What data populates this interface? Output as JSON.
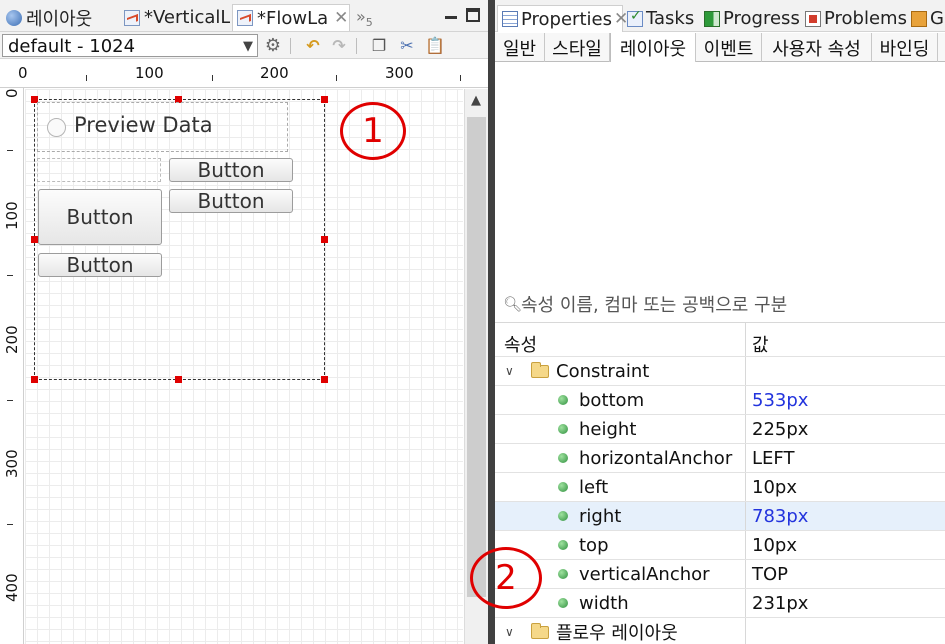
{
  "editor": {
    "tabs": [
      {
        "label": "레이아웃"
      },
      {
        "label": "*VerticalL"
      },
      {
        "label": "*FlowLa",
        "close": "✕"
      }
    ],
    "overflow_count": "5",
    "toolbar": {
      "resolution_value": "default - 1024",
      "icons": [
        "gear-icon",
        "undo-icon",
        "redo-icon",
        "copy-icon",
        "cut-icon",
        "paste-icon"
      ]
    },
    "ruler_top_labels": [
      "0",
      "100",
      "200",
      "300"
    ],
    "ruler_left_labels": [
      "0",
      "100",
      "200",
      "300",
      "400"
    ],
    "canvas": {
      "preview_label": "Preview Data",
      "buttons": [
        "Button",
        "Button",
        "Button",
        "Button"
      ]
    }
  },
  "annotations": {
    "one": "1",
    "two": "2",
    "color": "#e00000"
  },
  "properties": {
    "views": [
      {
        "label": "Properties",
        "close": "✕"
      },
      {
        "label": "Tasks"
      },
      {
        "label": "Progress"
      },
      {
        "label": "Problems"
      },
      {
        "label": "G"
      }
    ],
    "tabs": [
      "일반",
      "스타일",
      "레이아웃",
      "이벤트",
      "사용자 속성",
      "바인딩"
    ],
    "active_tab": "레이아웃",
    "filter_placeholder": "속성 이름, 컴마 또는 공백으로 구분",
    "columns": {
      "name": "속성",
      "value": "값"
    },
    "groups": {
      "constraint": {
        "label": "Constraint",
        "rows": [
          {
            "name": "bottom",
            "value": "533px"
          },
          {
            "name": "height",
            "value": "225px"
          },
          {
            "name": "horizontalAnchor",
            "value": "LEFT"
          },
          {
            "name": "left",
            "value": "10px"
          },
          {
            "name": "right",
            "value": "783px"
          },
          {
            "name": "top",
            "value": "10px"
          },
          {
            "name": "verticalAnchor",
            "value": "TOP"
          },
          {
            "name": "width",
            "value": "231px"
          }
        ]
      },
      "flow": {
        "label": "플로우 레이아웃"
      }
    },
    "value_highlight_color": "#2233dd"
  }
}
